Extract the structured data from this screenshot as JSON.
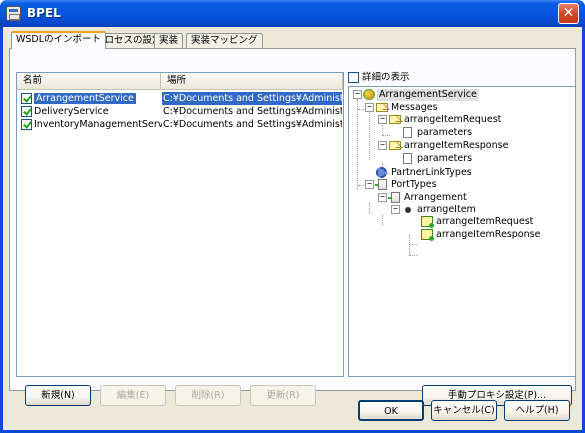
{
  "window": {
    "title": "BPEL",
    "close_glyph": "✕"
  },
  "tabs": [
    {
      "label": "WSDLのインポート",
      "active": true
    },
    {
      "label": "プロセスの設定",
      "active": false
    },
    {
      "label": "実装",
      "active": false
    },
    {
      "label": "実装マッピング",
      "active": false
    }
  ],
  "imports": {
    "columns": {
      "name": "名前",
      "location": "場所"
    },
    "rows": [
      {
        "name": "ArrangementService",
        "location": "C:¥Documents and Settings¥Administra...",
        "checked": true,
        "selected": true
      },
      {
        "name": "DeliveryService",
        "location": "C:¥Documents and Settings¥Administra...",
        "checked": true,
        "selected": false
      },
      {
        "name": "InventoryManagementService",
        "location": "C:¥Documents and Settings¥Administra...",
        "checked": true,
        "selected": false
      }
    ]
  },
  "details": {
    "show_details_label": "詳細の表示",
    "show_details_checked": false
  },
  "tree": {
    "root": "ArrangementService",
    "messages": "Messages",
    "request": "arrangeItemRequest",
    "request_param": "parameters",
    "response": "arrangeItemResponse",
    "response_param": "parameters",
    "partner_link_types": "PartnerLinkTypes",
    "port_types": "PortTypes",
    "arrangement": "Arrangement",
    "operation": "arrangeItem",
    "op_request": "arrangeItemRequest",
    "op_response": "arrangeItemResponse",
    "expanded_glyph": "−"
  },
  "panel_buttons": {
    "new": "新規(N)",
    "edit": "編集(E)",
    "delete": "削除(R)",
    "update": "更新(R)",
    "proxy": "手動プロキシ設定(P)..."
  },
  "dialog_buttons": {
    "ok": "OK",
    "cancel": "キャンセル(C)",
    "help": "ヘルプ(H)"
  },
  "colors": {
    "titlebar": "#0a5ce0",
    "selection": "#316ac5",
    "dialog_face": "#ece9d8"
  }
}
